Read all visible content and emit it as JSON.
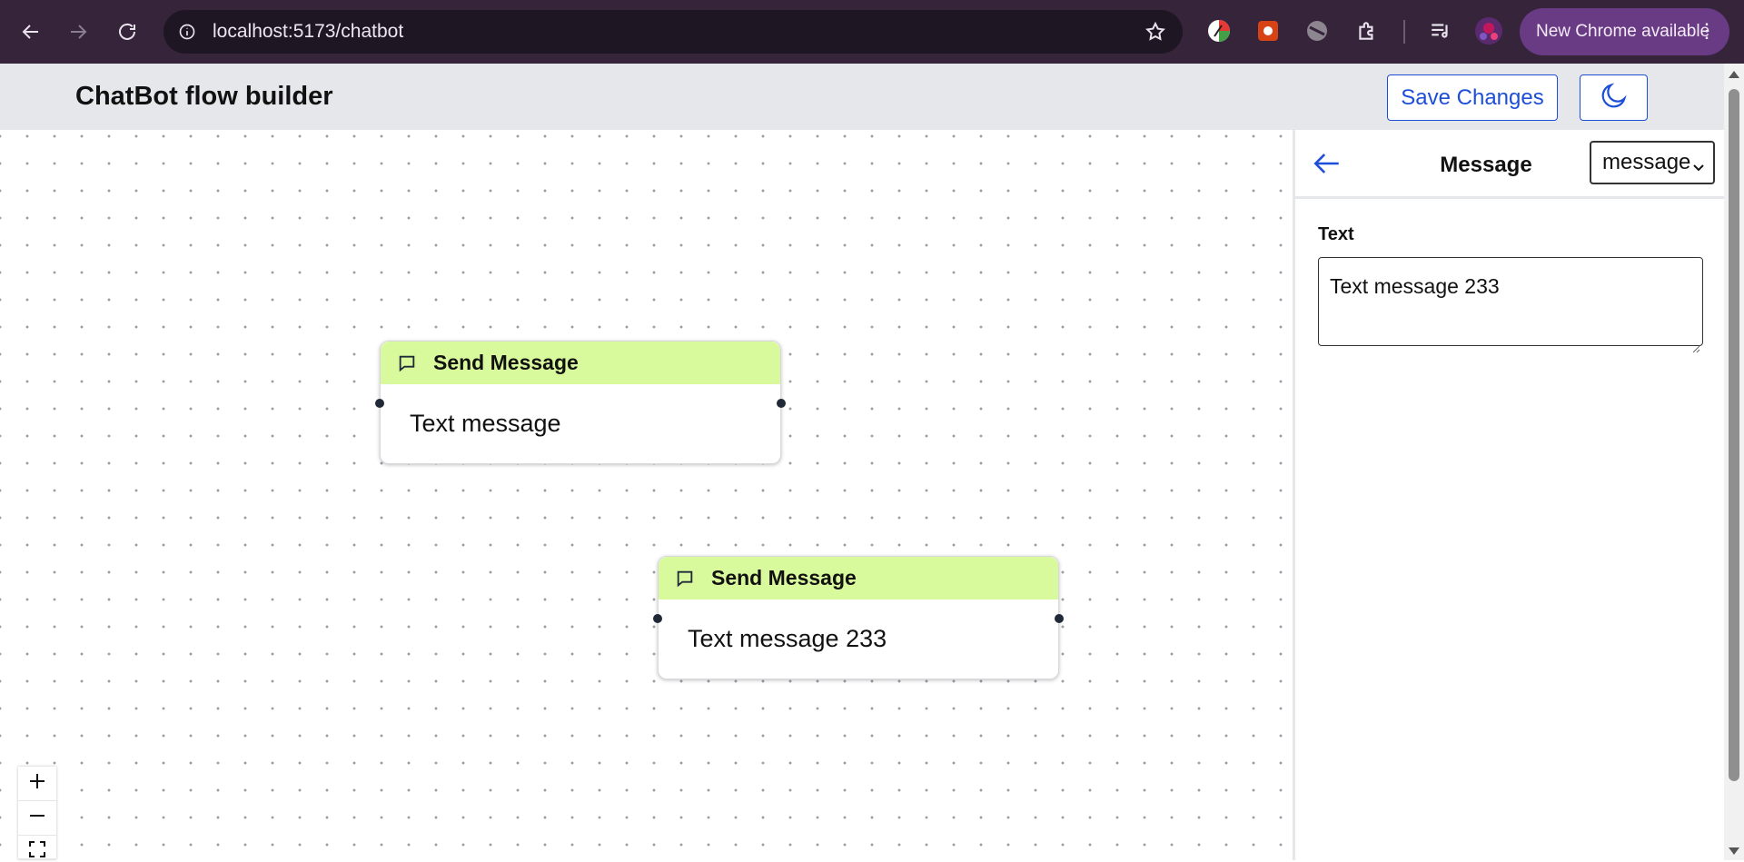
{
  "browser": {
    "url": "localhost:5173/chatbot",
    "update_label": "New Chrome available"
  },
  "header": {
    "title": "ChatBot flow builder",
    "save_label": "Save Changes"
  },
  "nodes": [
    {
      "title": "Send Message",
      "text": "Text message"
    },
    {
      "title": "Send Message",
      "text": "Text message 233"
    }
  ],
  "zoom": {
    "in": "+",
    "out": "−"
  },
  "panel": {
    "title": "Message",
    "select_value": "message",
    "field_label": "Text",
    "field_value": "Text message 233"
  },
  "colors": {
    "accent": "#1d4ed8",
    "node_header": "#d9f99d",
    "chrome_bg": "#35243a",
    "update_pill": "#6a3b85"
  }
}
